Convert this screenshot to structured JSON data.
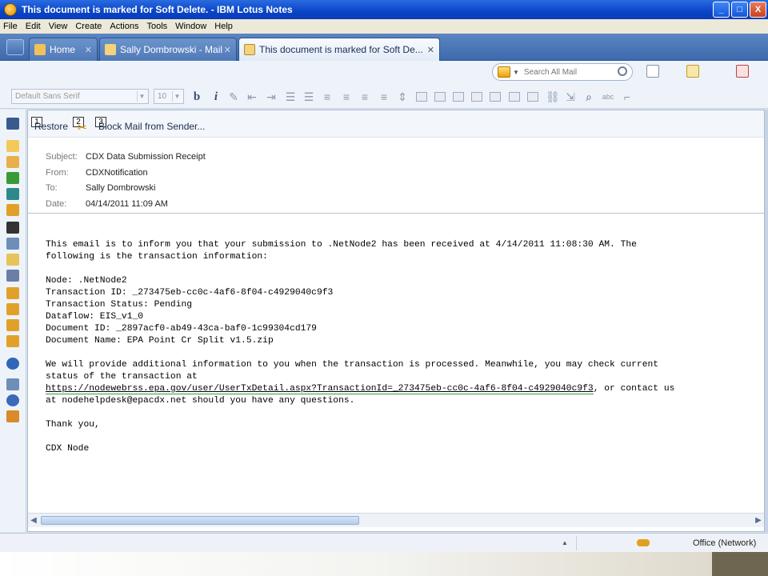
{
  "window": {
    "title": "This document is marked for Soft Delete. - IBM Lotus Notes",
    "buttons": {
      "minimize": "_",
      "maximize": "□",
      "close": "X"
    }
  },
  "menu": [
    "File",
    "Edit",
    "View",
    "Create",
    "Actions",
    "Tools",
    "Window",
    "Help"
  ],
  "tabs": [
    {
      "label": "Home",
      "active": false
    },
    {
      "label": "Sally Dombrowski - Mail",
      "active": false
    },
    {
      "label": "This document is marked for Soft De...",
      "active": true
    }
  ],
  "search": {
    "placeholder": "Search All Mail"
  },
  "format": {
    "font": "Default Sans Serif",
    "size": "10",
    "bold": "b",
    "italic": "i"
  },
  "actions": {
    "restore": "Restore",
    "block": "Block Mail from Sender...",
    "markers": [
      "1",
      "2",
      "3"
    ]
  },
  "header": {
    "subject_label": "Subject:",
    "subject": "CDX Data Submission Receipt",
    "from_label": "From:",
    "from": "CDXNotification",
    "to_label": "To:",
    "to": "Sally Dombrowski",
    "date_label": "Date:",
    "date": "04/14/2011 11:09 AM"
  },
  "body": {
    "p1l1": "This email is to inform you that your submission to .NetNode2 has been received at 4/14/2011 11:08:30 AM. The",
    "p1l2": "following is the transaction information:",
    "node": "Node: .NetNode2",
    "txid": "Transaction ID: _273475eb-cc0c-4af6-8f04-c4929040c9f3",
    "status": "Transaction Status: Pending",
    "dataflow": "Dataflow: EIS_v1_0",
    "docid": "Document ID: _2897acf0-ab49-43ca-baf0-1c99304cd179",
    "docname": "Document Name: EPA Point Cr Split v1.5.zip",
    "p3l1": "We will provide additional information to you when the transaction is processed. Meanwhile, you may check current",
    "p3l2": "status of the transaction at",
    "link": "https://nodewebrss.epa.gov/user/UserTxDetail.aspx?TransactionId=_273475eb-cc0c-4af6-8f04-c4929040c9f3",
    "p3l3tail": ", or contact us",
    "p3l4": "at nodehelpdesk@epacdx.net should you have any questions.",
    "thanks": "Thank you,",
    "sign": "CDX Node"
  },
  "status": {
    "location": "Office (Network)"
  }
}
